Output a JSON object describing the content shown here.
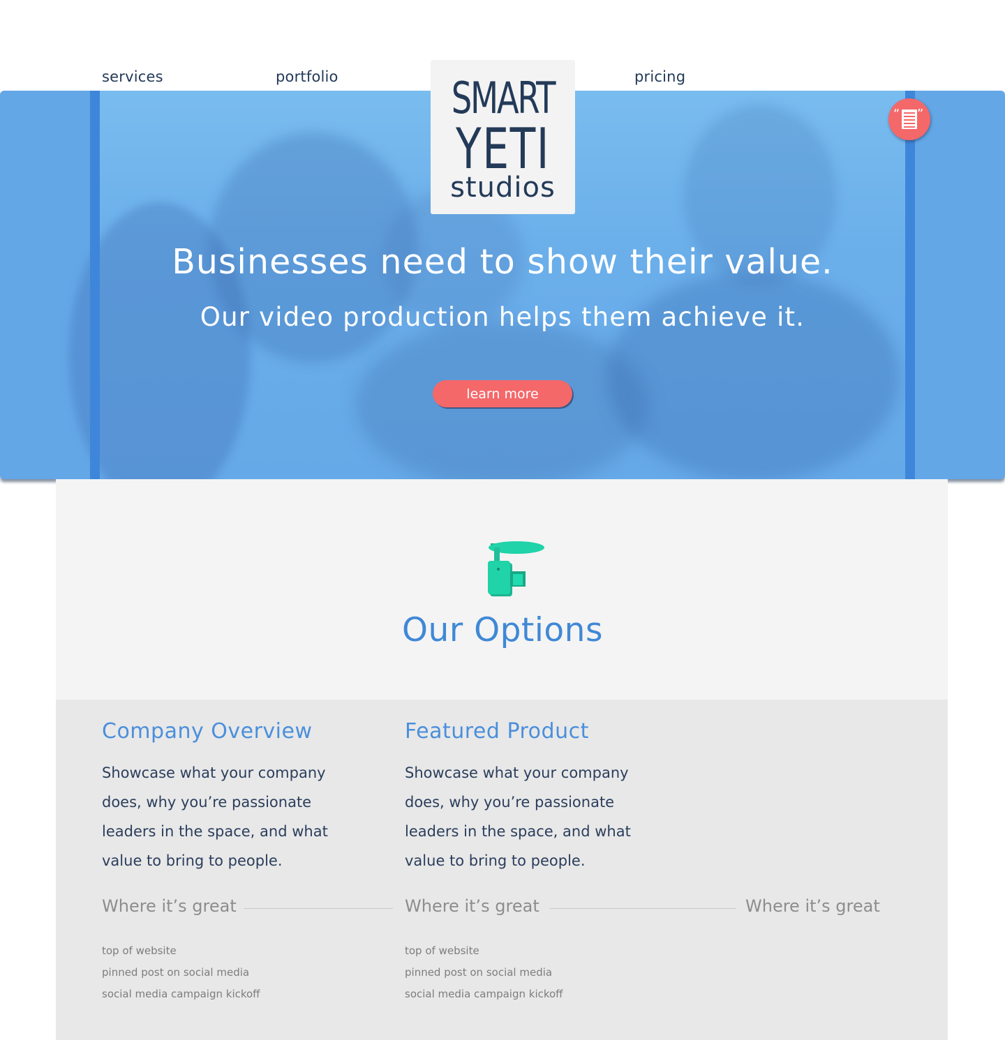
{
  "nav": {
    "services": "services",
    "portfolio": "portfolio",
    "pricing": "pricing"
  },
  "logo": {
    "line1": "SMART",
    "line2": "YETI",
    "line3": "studios"
  },
  "hero": {
    "title": "Businesses need to show their value.",
    "subtitle": "Our video production helps them achieve it.",
    "cta_label": "learn more"
  },
  "options": {
    "icon": "video-camera-icon",
    "title": "Our Options"
  },
  "columns": [
    {
      "title": "Company Overview",
      "body": "Showcase what your company does, why you’re passionate leaders in the space, and what value to bring to people.",
      "where_label": "Where it’s great",
      "uses": [
        "top of website",
        "pinned post on social media",
        "social media campaign kickoff"
      ]
    },
    {
      "title": "Featured Product",
      "body": "Showcase what your company does, why you’re passionate leaders in the space, and what value to bring to people.",
      "where_label": "Where it’s great",
      "uses": [
        "top of website",
        "pinned post on social media",
        "social media campaign kickoff"
      ]
    },
    {
      "where_label": "Where it’s great"
    }
  ],
  "colors": {
    "accent_blue": "#3f88d6",
    "cta_red": "#f4686a",
    "hero_blue": "#64a7e7",
    "camera_teal": "#1fcfa6"
  }
}
